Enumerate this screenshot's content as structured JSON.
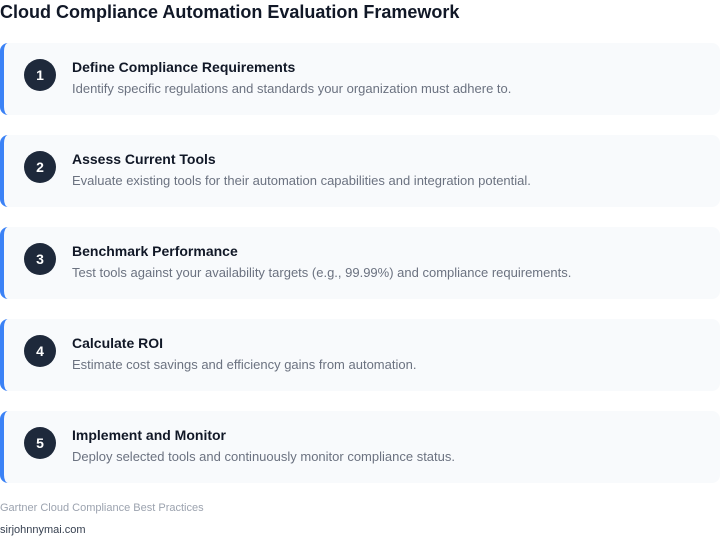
{
  "title": "Cloud Compliance Automation Evaluation Framework",
  "accent_color": "#3b82f6",
  "badge_color": "#1e293b",
  "steps": [
    {
      "number": "1",
      "title": "Define Compliance Requirements",
      "description": "Identify specific regulations and standards your organization must adhere to."
    },
    {
      "number": "2",
      "title": "Assess Current Tools",
      "description": "Evaluate existing tools for their automation capabilities and integration potential."
    },
    {
      "number": "3",
      "title": "Benchmark Performance",
      "description": "Test tools against your availability targets (e.g., 99.99%) and compliance requirements."
    },
    {
      "number": "4",
      "title": "Calculate ROI",
      "description": "Estimate cost savings and efficiency gains from automation."
    },
    {
      "number": "5",
      "title": "Implement and Monitor",
      "description": "Deploy selected tools and continuously monitor compliance status."
    }
  ],
  "footer": {
    "source": "Gartner Cloud Compliance Best Practices",
    "credit": "sirjohnnymai.com"
  }
}
